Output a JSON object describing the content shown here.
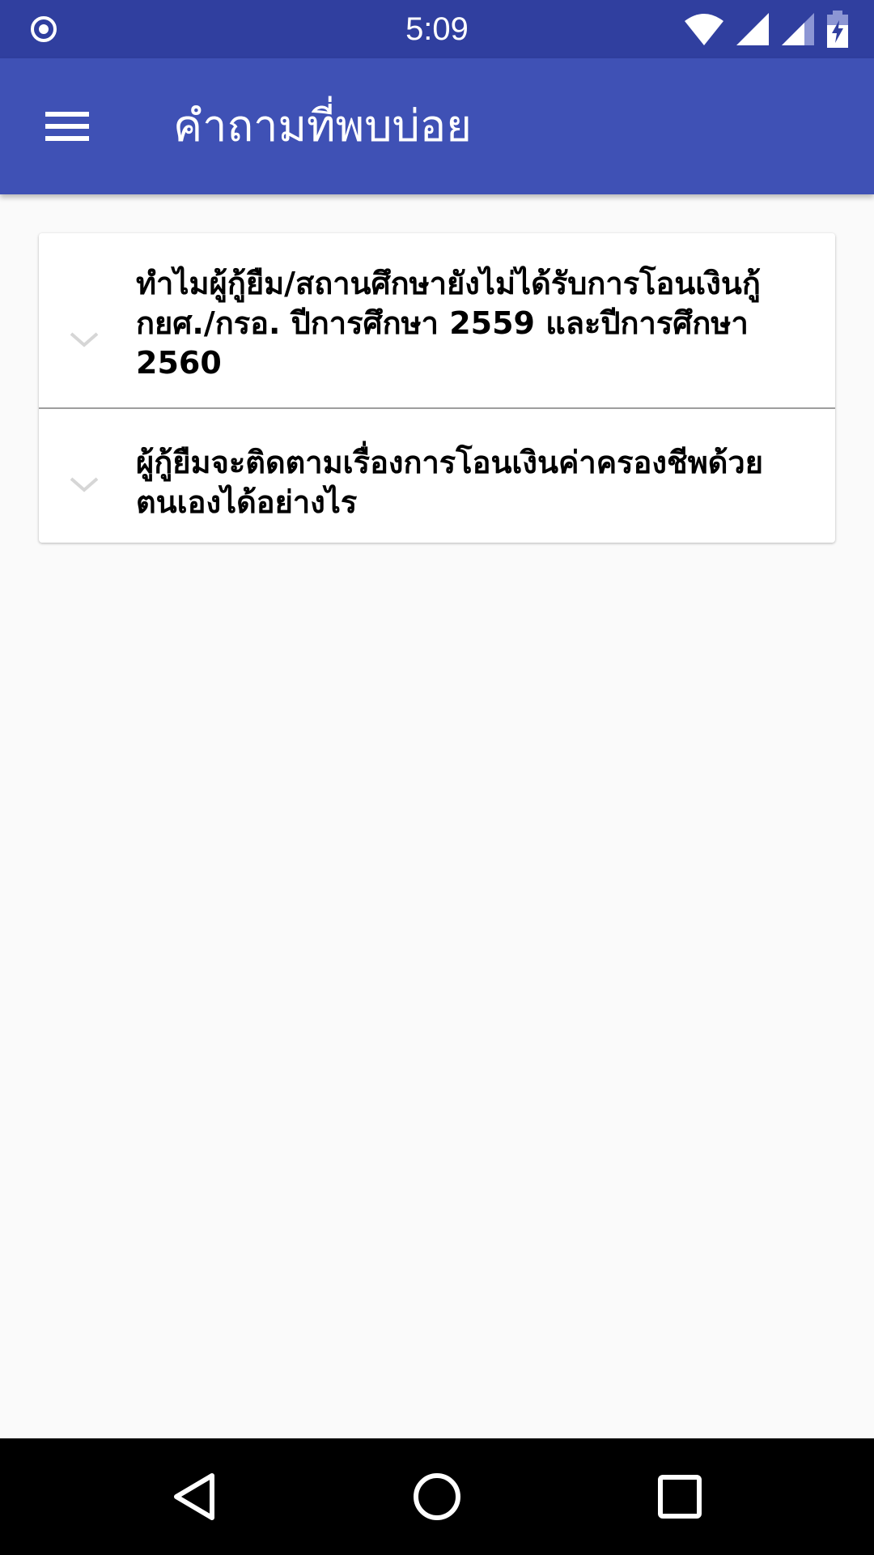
{
  "status_bar": {
    "time": "5:09",
    "icons": [
      "target-icon",
      "wifi-icon",
      "cell-signal-icon",
      "cell-signal-secondary-icon",
      "battery-charging-icon"
    ]
  },
  "app_bar": {
    "title": "คำถามที่พบบ่อย",
    "menu_icon": "hamburger-menu-icon"
  },
  "faq": {
    "items": [
      {
        "question": "ทำไมผู้กู้ยืม/สถานศึกษายังไม่ได้รับการโอนเงินกู้ กยศ./กรอ. ปีการศึกษา 2559 และปีการศึกษา 2560",
        "icon": "chevron-down-icon"
      },
      {
        "question": "ผู้กู้ยืมจะติดตามเรื่องการโอนเงินค่าครองชีพด้วยตนเองได้อย่างไร",
        "icon": "chevron-down-icon"
      }
    ]
  },
  "nav_bar": {
    "icons": [
      "back-icon",
      "home-icon",
      "recents-icon"
    ]
  },
  "colors": {
    "status_bar": "#303f9f",
    "app_bar": "#3f51b5",
    "background": "#fafafa",
    "card": "#ffffff",
    "divider": "#9e9e9e",
    "chevron": "#d6d6d6",
    "nav_bar": "#000000"
  }
}
